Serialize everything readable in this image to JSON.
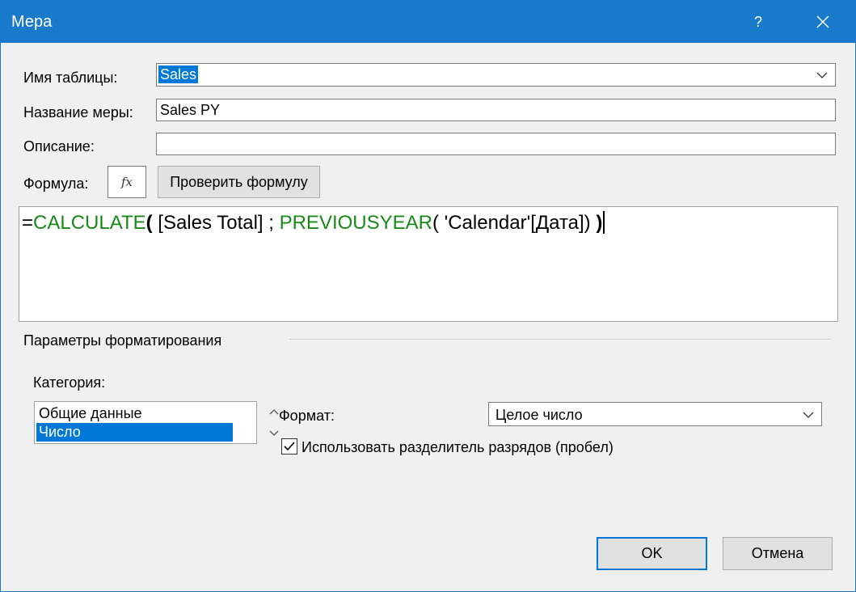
{
  "window": {
    "title": "Мера",
    "help_label": "?",
    "close_icon": "close-icon"
  },
  "form": {
    "table_name_label": "Имя таблицы:",
    "table_name_value": "Sales",
    "measure_name_label": "Название меры:",
    "measure_name_value": "Sales PY",
    "description_label": "Описание:",
    "description_value": "",
    "formula_label": "Формула:",
    "fx_label": "fx",
    "check_formula_label": "Проверить формулу"
  },
  "formula": {
    "equals": "=",
    "fn1": "CALCULATE",
    "paren_open": "(",
    "arg1": " [Sales Total] ; ",
    "fn2": "PREVIOUSYEAR",
    "arg2": "( 'Calendar'[Дата]) ",
    "paren_close": ")"
  },
  "formatting": {
    "group_label": "Параметры форматирования",
    "category_label": "Категория:",
    "categories": [
      "Общие данные",
      "Число"
    ],
    "selected_category": "Число",
    "format_label": "Формат:",
    "format_value": "Целое число",
    "separator_label": "Использовать разделитель разрядов (пробел)",
    "separator_checked": true
  },
  "buttons": {
    "ok_label": "OK",
    "cancel_label": "Отмена"
  },
  "colors": {
    "title_bar": "#1979ca",
    "selection": "#0078d7",
    "function_green": "#178a17"
  }
}
